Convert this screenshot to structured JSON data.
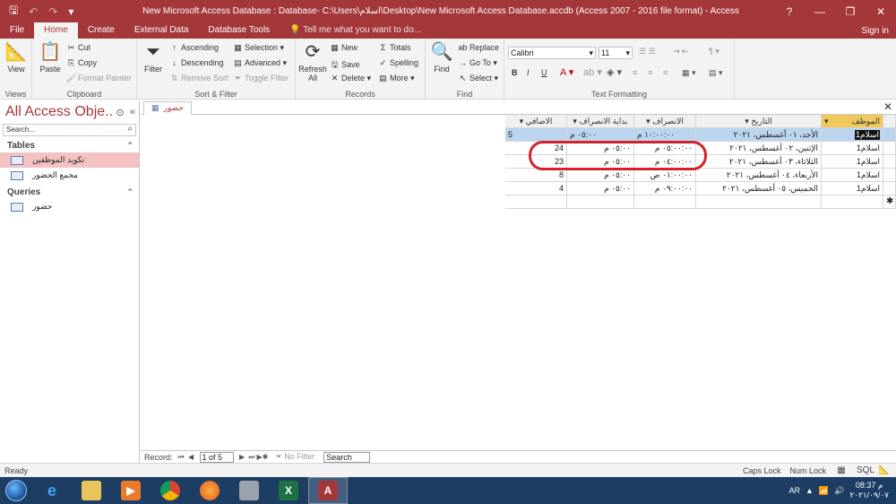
{
  "window": {
    "title": "New Microsoft Access Database : Database- C:\\Users\\اسلام\\Desktop\\New Microsoft Access Database.accdb (Access 2007 - 2016 file format) - Access",
    "help": "?",
    "minimize": "—",
    "restore": "❐",
    "close": "✕"
  },
  "ribbon_tabs": [
    "File",
    "Home",
    "Create",
    "External Data",
    "Database Tools"
  ],
  "tell_me": "Tell me what you want to do...",
  "sign_in": "Sign in",
  "ribbon": {
    "views": {
      "view": "View",
      "label": "Views"
    },
    "clipboard": {
      "paste": "Paste",
      "cut": "Cut",
      "copy": "Copy",
      "format_painter": "Format Painter",
      "label": "Clipboard"
    },
    "sort_filter": {
      "filter": "Filter",
      "ascending": "Ascending",
      "descending": "Descending",
      "remove_sort": "Remove Sort",
      "selection": "Selection",
      "advanced": "Advanced",
      "toggle_filter": "Toggle Filter",
      "label": "Sort & Filter"
    },
    "records": {
      "refresh": "Refresh",
      "refresh_all": "All",
      "new": "New",
      "save": "Save",
      "delete": "Delete",
      "totals": "Totals",
      "spelling": "Spelling",
      "more": "More",
      "label": "Records"
    },
    "find": {
      "find": "Find",
      "replace": "Replace",
      "goto": "Go To",
      "select": "Select",
      "label": "Find"
    },
    "text_formatting": {
      "font": "Calibri",
      "size": "11",
      "bold": "B",
      "italic": "I",
      "underline": "U",
      "label": "Text Formatting"
    }
  },
  "nav": {
    "title": "All Access Obje...",
    "search_placeholder": "Search...",
    "sections": [
      {
        "name": "Tables",
        "items": [
          "تكويد الموظفين",
          "مجمع الحضور"
        ]
      },
      {
        "name": "Queries",
        "items": [
          "حضور"
        ]
      }
    ]
  },
  "doc_tab": "حضور",
  "datasheet": {
    "columns": [
      "الموظف",
      "التاريخ",
      "الانصراف",
      "بداية الانصراف",
      "الاضافي"
    ],
    "rows": [
      {
        "emp": "اسلام1",
        "date": "الأحد، ٠١ أغسطس، ٢٠٢١",
        "out": "١٠:٠٠:٠٠ م",
        "start": "٠٥:٠٠ م",
        "extra": "5"
      },
      {
        "emp": "اسلام1",
        "date": "الإثنين، ٠٢ أغسطس، ٢٠٢١",
        "out": "٠٥:٠٠:٠٠ م",
        "start": "٠٥:٠٠ م",
        "extra": "24"
      },
      {
        "emp": "اسلام1",
        "date": "الثلاثاء، ٠٣ أغسطس، ٢٠٢١",
        "out": "٠٤:٠٠:٠٠ م",
        "start": "٠٥:٠٠ م",
        "extra": "23"
      },
      {
        "emp": "اسلام1",
        "date": "الأربعاء، ٠٤ أغسطس، ٢٠٢١",
        "out": "٠١:٠٠:٠٠ ص",
        "start": "٠٥:٠٠ م",
        "extra": "8"
      },
      {
        "emp": "اسلام1",
        "date": "الخميس، ٠٥ أغسطس، ٢٠٢١",
        "out": "٠٩:٠٠:٠٠ م",
        "start": "٠٥:٠٠ م",
        "extra": "4"
      }
    ]
  },
  "record_nav": {
    "label": "Record:",
    "position": "1 of 5",
    "no_filter": "No Filter",
    "search": "Search"
  },
  "status": {
    "ready": "Ready",
    "caps_lock": "Caps Lock",
    "num_lock": "Num Lock"
  },
  "taskbar": {
    "lang": "AR",
    "time": "08:37 م",
    "date": "٢٠٢١/٠٩/٠٧"
  },
  "colors": {
    "accent": "#a4373a",
    "selected_row": "#bcd5ef",
    "highlight_oval": "#d0232a",
    "taskbar": "#1d3d63"
  }
}
